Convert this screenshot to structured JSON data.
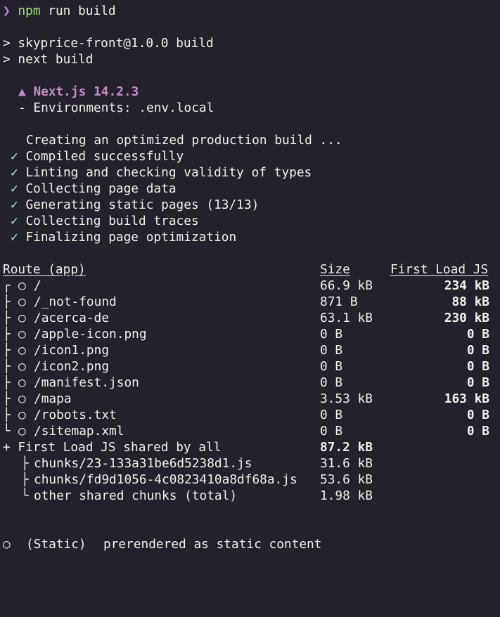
{
  "terminal": {
    "top_partial": "⎯  ·  ·  ·  ,  · ,  ·  ·  ·",
    "prompt_symbol": "❯",
    "command_npm": "npm",
    "command_rest": " run build",
    "script_line1": "> skyprice-front@1.0.0 build",
    "script_line2": "> next build",
    "next_logo": "▲",
    "next_version": "Next.js 14.2.3",
    "env_line": "- Environments: .env.local",
    "creating": "Creating an optimized production build ...",
    "check_symbol": "✓",
    "steps": [
      "Compiled successfully",
      "Linting and checking validity of types",
      "Collecting page data",
      "Generating static pages (13/13)",
      "Collecting build traces",
      "Finalizing page optimization"
    ]
  },
  "routes_table": {
    "headers": {
      "route": "Route (app)",
      "size": "Size",
      "first_load": "First Load JS"
    },
    "rows": [
      {
        "tree": "┌",
        "marker": "○",
        "route": "/",
        "size": "66.9 kB",
        "first_load": "234 kB"
      },
      {
        "tree": "├",
        "marker": "○",
        "route": "/_not-found",
        "size": "871 B",
        "first_load": "88 kB"
      },
      {
        "tree": "├",
        "marker": "○",
        "route": "/acerca-de",
        "size": "63.1 kB",
        "first_load": "230 kB"
      },
      {
        "tree": "├",
        "marker": "○",
        "route": "/apple-icon.png",
        "size": "0 B",
        "first_load": "0 B"
      },
      {
        "tree": "├",
        "marker": "○",
        "route": "/icon1.png",
        "size": "0 B",
        "first_load": "0 B"
      },
      {
        "tree": "├",
        "marker": "○",
        "route": "/icon2.png",
        "size": "0 B",
        "first_load": "0 B"
      },
      {
        "tree": "├",
        "marker": "○",
        "route": "/manifest.json",
        "size": "0 B",
        "first_load": "0 B"
      },
      {
        "tree": "├",
        "marker": "○",
        "route": "/mapa",
        "size": "3.53 kB",
        "first_load": "163 kB"
      },
      {
        "tree": "├",
        "marker": "○",
        "route": "/robots.txt",
        "size": "0 B",
        "first_load": "0 B"
      },
      {
        "tree": "└",
        "marker": "○",
        "route": "/sitemap.xml",
        "size": "0 B",
        "first_load": "0 B"
      }
    ],
    "shared": {
      "label": "+ First Load JS shared by all",
      "value": "87.2 kB",
      "chunks": [
        {
          "tree": "├",
          "name": "chunks/23-133a31be6d5238d1.js",
          "size": "31.6 kB"
        },
        {
          "tree": "├",
          "name": "chunks/fd9d1056-4c0823410a8df68a.js",
          "size": "53.6 kB"
        },
        {
          "tree": "└",
          "name": "other shared chunks (total)",
          "size": "1.98 kB"
        }
      ]
    }
  },
  "legend": {
    "marker": "○",
    "label": "(Static)",
    "description": "prerendered as static content"
  }
}
